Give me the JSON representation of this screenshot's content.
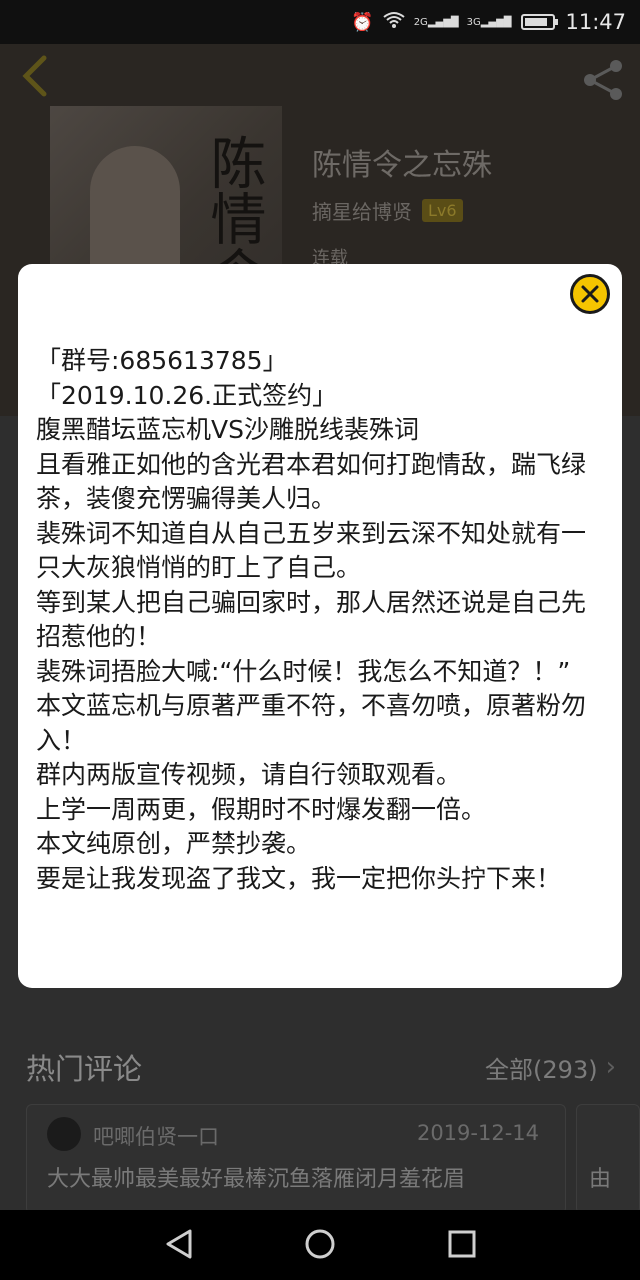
{
  "status_bar": {
    "time": "11:47",
    "network_1": "2G",
    "network_2": "3G"
  },
  "book": {
    "title": "陈情令之忘殊",
    "author": "摘星给博贤",
    "level": "Lv6",
    "status": "连载",
    "cover_text": "陈情令"
  },
  "comments": {
    "title": "热门评论",
    "all_label": "全部(293)",
    "items": [
      {
        "user": "吧唧伯贤一口",
        "date": "2019-12-14",
        "text": "大大最帅最美最好最棒沉鱼落雁闭月羞花眉"
      }
    ],
    "second_card_text": "由"
  },
  "modal": {
    "lines": [
      "「群号:685613785」",
      "「2019.10.26.正式签约」",
      "腹黑醋坛蓝忘机VS沙雕脱线裴殊词",
      "且看雅正如他的含光君本君如何打跑情敌，踹飞绿茶，装傻充愣骗得美人归。",
      "裴殊词不知道自从自己五岁来到云深不知处就有一只大灰狼悄悄的盯上了自己。",
      "等到某人把自己骗回家时，那人居然还说是自己先招惹他的！",
      "裴殊词捂脸大喊:“什么时候！我怎么不知道？！”",
      "本文蓝忘机与原著严重不符，不喜勿喷，原著粉勿入！",
      "群内两版宣传视频，请自行领取观看。",
      "上学一周两更，假期时不时爆发翻一倍。",
      "本文纯原创，严禁抄袭。",
      "要是让我发现盗了我文，我一定把你头拧下来！"
    ]
  },
  "colors": {
    "accent": "#f5c400",
    "modal_bg": "#ffffff",
    "page_dim": "#2e2e2e"
  }
}
